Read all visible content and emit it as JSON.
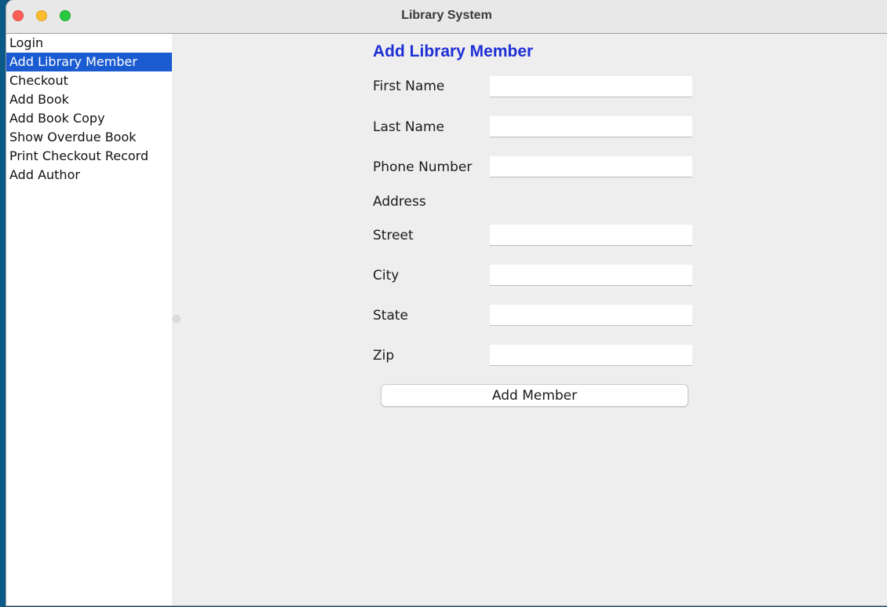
{
  "window": {
    "title": "Library System"
  },
  "sidebar": {
    "items": [
      {
        "label": "Login",
        "selected": false
      },
      {
        "label": "Add Library Member",
        "selected": true
      },
      {
        "label": "Checkout",
        "selected": false
      },
      {
        "label": "Add Book",
        "selected": false
      },
      {
        "label": "Add Book Copy",
        "selected": false
      },
      {
        "label": "Show Overdue Book",
        "selected": false
      },
      {
        "label": "Print Checkout Record",
        "selected": false
      },
      {
        "label": "Add Author",
        "selected": false
      }
    ]
  },
  "form": {
    "title": "Add Library Member",
    "first_name": {
      "label": "First Name",
      "value": ""
    },
    "last_name": {
      "label": "Last Name",
      "value": ""
    },
    "phone": {
      "label": "Phone Number",
      "value": ""
    },
    "address_heading": "Address",
    "street": {
      "label": "Street",
      "value": ""
    },
    "city": {
      "label": "City",
      "value": ""
    },
    "state": {
      "label": "State",
      "value": ""
    },
    "zip": {
      "label": "Zip",
      "value": ""
    },
    "submit_label": "Add Member"
  },
  "colors": {
    "title_blue": "#1e2fd6",
    "selection_blue": "#1a5bd1",
    "desktop": "#0e4f7a"
  }
}
